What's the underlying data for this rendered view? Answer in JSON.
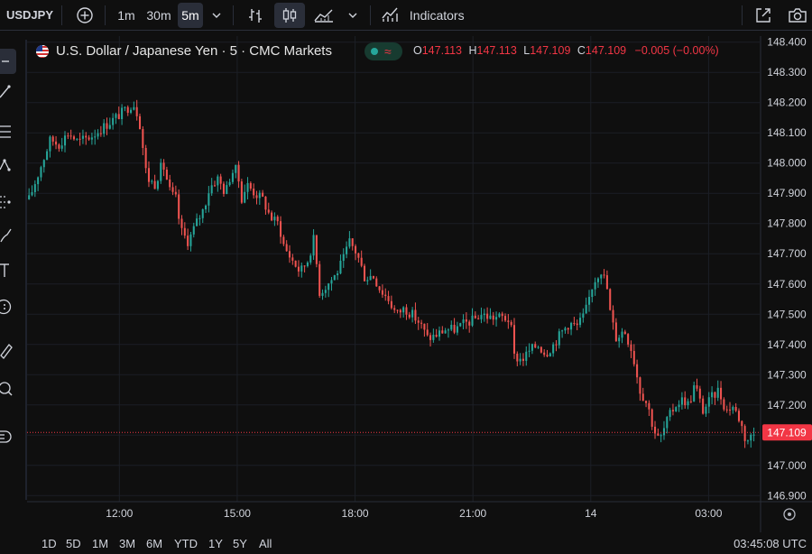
{
  "toolbar": {
    "symbol": "USDJPY",
    "intervals": [
      "1m",
      "30m",
      "5m"
    ],
    "active_interval": "5m",
    "indicators_label": "Indicators"
  },
  "legend": {
    "title": "U.S. Dollar / Japanese Yen · 5 · CMC Markets",
    "badge_symbol": "≈",
    "o_key": "O",
    "o_val": "147.113",
    "h_key": "H",
    "h_val": "147.113",
    "l_key": "L",
    "l_val": "147.109",
    "c_key": "C",
    "c_val": "147.109",
    "change": "−0.005 (−0.00%)"
  },
  "bottom": {
    "ranges": [
      "1D",
      "5D",
      "1M",
      "3M",
      "6M",
      "YTD",
      "1Y",
      "5Y",
      "All"
    ],
    "clock": "03:45:08 UTC"
  },
  "colors": {
    "up": "#26a69a",
    "down": "#ef5350",
    "background": "#0f0f0f",
    "grid": "#1c1f26",
    "price_line": "#f23645"
  },
  "chart_data": {
    "type": "candlestick",
    "symbol": "USDJPY",
    "interval": "5m",
    "y_ticks": [
      148.4,
      148.3,
      148.2,
      148.1,
      148.0,
      147.9,
      147.8,
      147.7,
      147.6,
      147.5,
      147.4,
      147.3,
      147.2,
      147.1,
      147.0,
      146.9
    ],
    "y_tick_labels": [
      "148.400",
      "148.300",
      "148.200",
      "148.100",
      "148.000",
      "147.900",
      "147.800",
      "147.700",
      "147.600",
      "147.500",
      "147.400",
      "147.300",
      "147.200",
      "147.100",
      "147.000",
      "146.900"
    ],
    "ylim": [
      146.88,
      148.42
    ],
    "x_ticks": [
      {
        "label": "12:00",
        "t": 0
      },
      {
        "label": "15:00",
        "t": 3
      },
      {
        "label": "18:00",
        "t": 6
      },
      {
        "label": "21:00",
        "t": 9
      },
      {
        "label": "14",
        "t": 12
      },
      {
        "label": "03:00",
        "t": 15
      }
    ],
    "xlim": [
      -2.35,
      16.3
    ],
    "last_price": 147.109,
    "last_price_label": "147.109",
    "path": [
      [
        -2.3,
        147.88
      ],
      [
        -2.05,
        147.97
      ],
      [
        -1.75,
        148.08
      ],
      [
        -1.55,
        148.06
      ],
      [
        -1.3,
        148.1
      ],
      [
        -1.05,
        148.07
      ],
      [
        -0.7,
        148.09
      ],
      [
        -0.3,
        148.13
      ],
      [
        0.1,
        148.17
      ],
      [
        0.35,
        148.2
      ],
      [
        0.5,
        148.15
      ],
      [
        0.7,
        147.95
      ],
      [
        0.9,
        147.93
      ],
      [
        1.1,
        148.0
      ],
      [
        1.3,
        147.9
      ],
      [
        1.45,
        147.88
      ],
      [
        1.55,
        147.78
      ],
      [
        1.75,
        147.74
      ],
      [
        1.95,
        147.8
      ],
      [
        2.15,
        147.85
      ],
      [
        2.3,
        147.92
      ],
      [
        2.5,
        147.95
      ],
      [
        2.7,
        147.9
      ],
      [
        2.85,
        147.97
      ],
      [
        3.0,
        147.98
      ],
      [
        3.1,
        147.88
      ],
      [
        3.25,
        147.93
      ],
      [
        3.45,
        147.9
      ],
      [
        3.65,
        147.88
      ],
      [
        3.85,
        147.82
      ],
      [
        4.05,
        147.8
      ],
      [
        4.2,
        147.72
      ],
      [
        4.4,
        147.68
      ],
      [
        4.6,
        147.64
      ],
      [
        4.8,
        147.68
      ],
      [
        4.95,
        147.75
      ],
      [
        5.1,
        147.57
      ],
      [
        5.3,
        147.6
      ],
      [
        5.5,
        147.63
      ],
      [
        5.7,
        147.68
      ],
      [
        5.85,
        147.74
      ],
      [
        6.05,
        147.7
      ],
      [
        6.25,
        147.62
      ],
      [
        6.45,
        147.63
      ],
      [
        6.65,
        147.58
      ],
      [
        6.85,
        147.55
      ],
      [
        7.05,
        147.5
      ],
      [
        7.25,
        147.52
      ],
      [
        7.45,
        147.5
      ],
      [
        7.65,
        147.47
      ],
      [
        7.85,
        147.42
      ],
      [
        8.05,
        147.43
      ],
      [
        8.3,
        147.45
      ],
      [
        8.55,
        147.45
      ],
      [
        8.8,
        147.47
      ],
      [
        9.0,
        147.48
      ],
      [
        9.2,
        147.5
      ],
      [
        9.45,
        147.49
      ],
      [
        9.75,
        147.49
      ],
      [
        9.95,
        147.48
      ],
      [
        10.05,
        147.36
      ],
      [
        10.25,
        147.35
      ],
      [
        10.45,
        147.38
      ],
      [
        10.65,
        147.4
      ],
      [
        10.85,
        147.37
      ],
      [
        11.05,
        147.4
      ],
      [
        11.25,
        147.44
      ],
      [
        11.45,
        147.47
      ],
      [
        11.65,
        147.46
      ],
      [
        11.85,
        147.5
      ],
      [
        12.05,
        147.6
      ],
      [
        12.25,
        147.65
      ],
      [
        12.4,
        147.6
      ],
      [
        12.5,
        147.5
      ],
      [
        12.65,
        147.42
      ],
      [
        12.85,
        147.45
      ],
      [
        13.05,
        147.38
      ],
      [
        13.25,
        147.25
      ],
      [
        13.45,
        147.2
      ],
      [
        13.6,
        147.12
      ],
      [
        13.75,
        147.08
      ],
      [
        13.95,
        147.15
      ],
      [
        14.15,
        147.2
      ],
      [
        14.35,
        147.22
      ],
      [
        14.5,
        147.2
      ],
      [
        14.65,
        147.27
      ],
      [
        14.85,
        147.18
      ],
      [
        15.05,
        147.22
      ],
      [
        15.25,
        147.25
      ],
      [
        15.45,
        147.18
      ],
      [
        15.6,
        147.2
      ],
      [
        15.8,
        147.15
      ],
      [
        15.95,
        147.08
      ],
      [
        16.2,
        147.11
      ]
    ]
  }
}
